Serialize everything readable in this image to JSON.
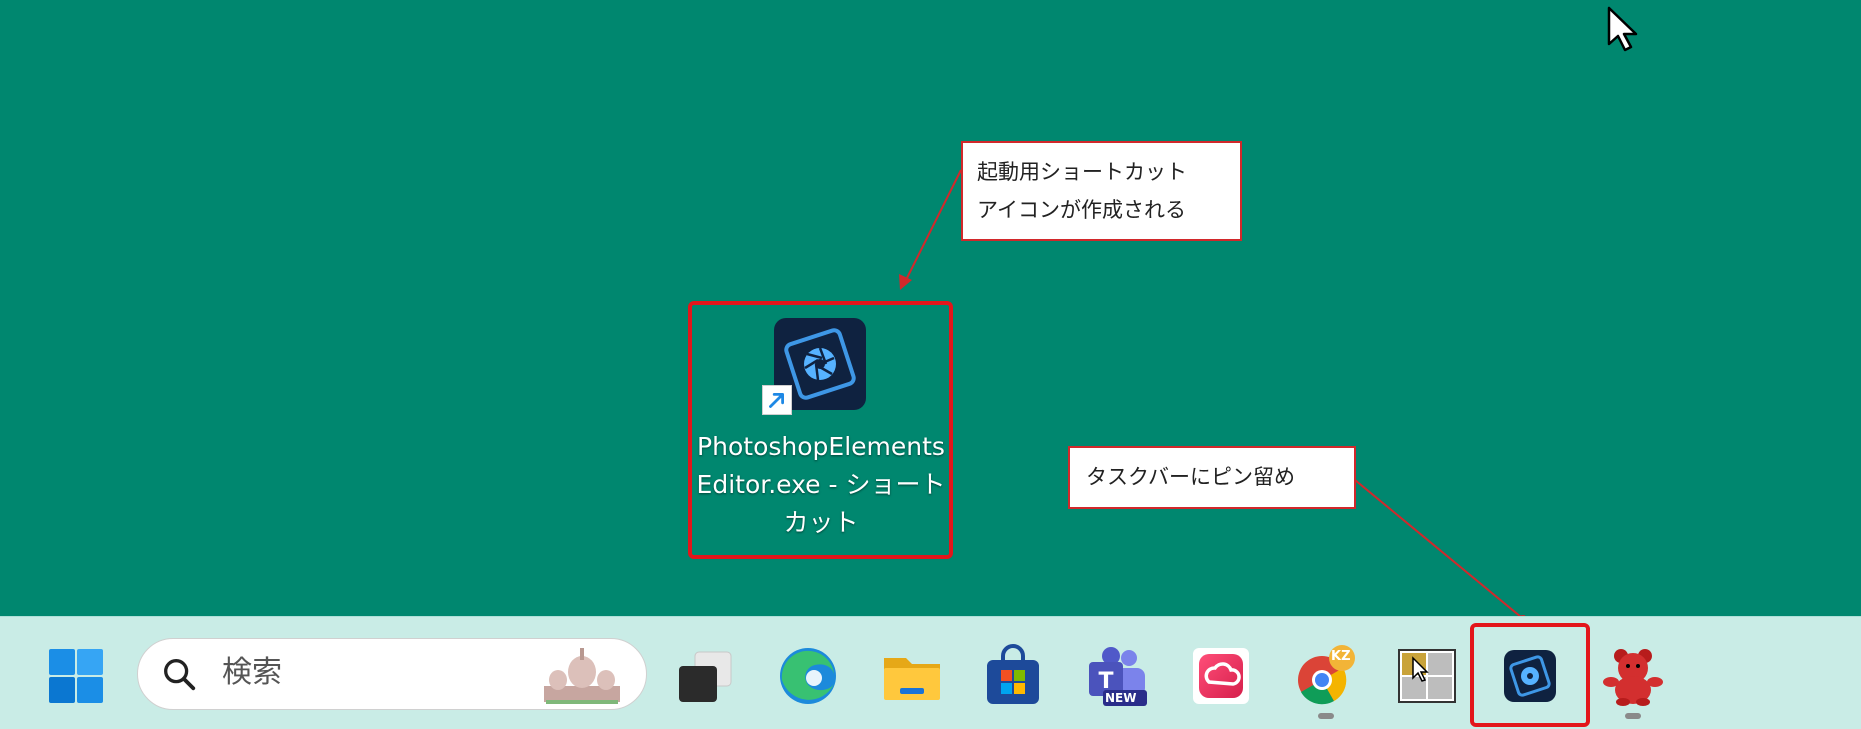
{
  "desktop": {
    "shortcut": {
      "label": "PhotoshopElementsEditor.exe - ショートカット",
      "icon": "photoshop-elements-icon",
      "overlay_icon": "shortcut-arrow-icon"
    }
  },
  "annotations": {
    "shortcut_callout": {
      "line1": "起動用ショートカット",
      "line2": "アイコンが作成される"
    },
    "taskbar_callout": "タスクバーにピン留め",
    "accent_color": "#e3161b"
  },
  "taskbar": {
    "search": {
      "placeholder": "検索",
      "icon": "search-icon",
      "highlight_icon": "sacre-coeur-icon"
    },
    "items": [
      {
        "name": "start-icon"
      },
      {
        "name": "task-view-icon"
      },
      {
        "name": "edge-icon"
      },
      {
        "name": "file-explorer-icon"
      },
      {
        "name": "microsoft-store-icon"
      },
      {
        "name": "teams-icon",
        "badge": "NEW"
      },
      {
        "name": "creative-cloud-icon"
      },
      {
        "name": "chrome-icon",
        "badge": "KZ"
      },
      {
        "name": "window-layout-icon"
      },
      {
        "name": "photoshop-elements-icon"
      },
      {
        "name": "red-bear-icon"
      }
    ]
  },
  "colors": {
    "desktop_background": "#00876f",
    "taskbar_background": "#c9ece6",
    "highlight_border": "#e3161b"
  }
}
